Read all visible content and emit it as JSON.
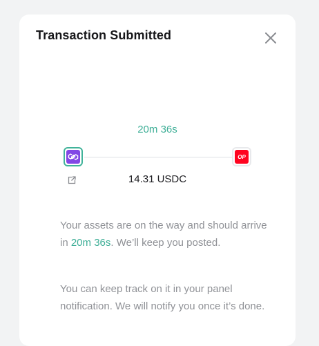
{
  "modal": {
    "title": "Transaction Submitted",
    "close_icon": "close-icon"
  },
  "transfer": {
    "eta": "20m 36s",
    "amount": "14.31 USDC",
    "from_chain_icon": "polygon-chain-icon",
    "to_chain_icon": "optimism-chain-icon",
    "to_chain_badge_text": "OP",
    "explorer_icon": "external-link-icon"
  },
  "message": {
    "part1": "Your assets are on the way and should arrive in ",
    "eta": "20m 36s",
    "part2": ". We’ll keep you posted.",
    "tracking": "You can keep track on it in your panel notification. We will notify you once it’s done."
  },
  "colors": {
    "accent": "#3dae96",
    "polygon": "#8247e5",
    "optimism": "#ff0420",
    "muted_text": "#8f9196"
  }
}
